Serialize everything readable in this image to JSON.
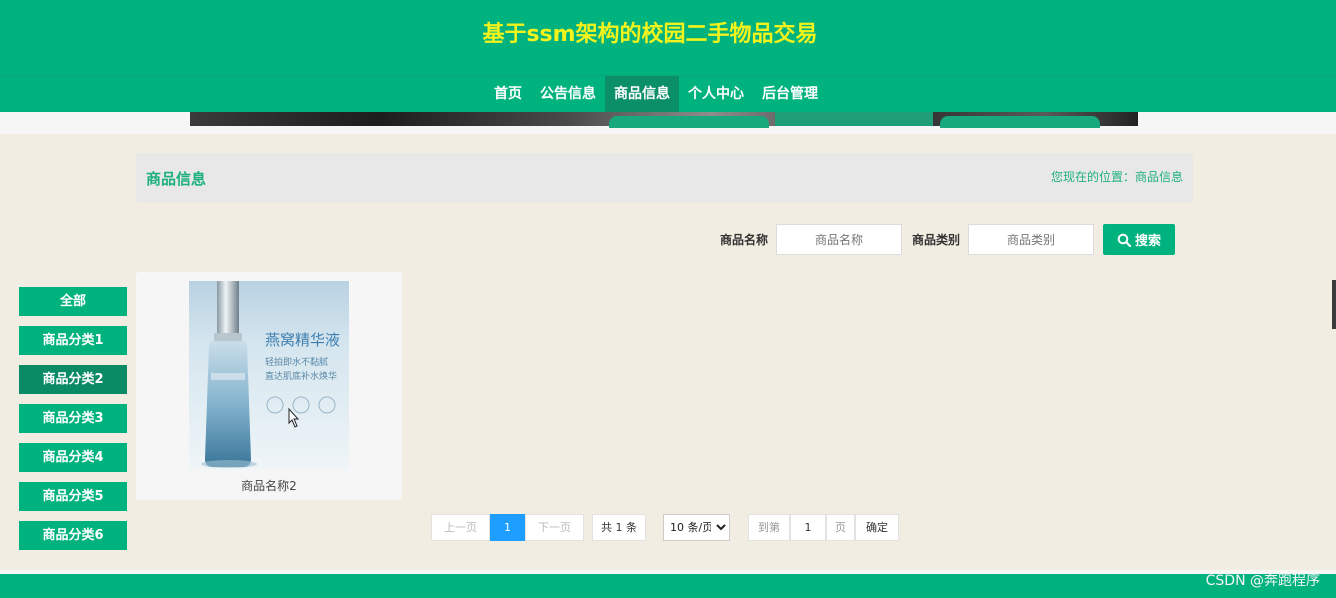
{
  "site": {
    "title": "基于ssm架构的校园二手物品交易"
  },
  "nav": {
    "items": [
      {
        "label": "首页"
      },
      {
        "label": "公告信息"
      },
      {
        "label": "商品信息",
        "active": true
      },
      {
        "label": "个人中心"
      },
      {
        "label": "后台管理"
      }
    ]
  },
  "page": {
    "title": "商品信息",
    "location": "您现在的位置：商品信息"
  },
  "search": {
    "name_label": "商品名称",
    "name_placeholder": "商品名称",
    "category_label": "商品类别",
    "category_placeholder": "商品类别",
    "button_label": "搜索"
  },
  "sidebar": {
    "items": [
      {
        "label": "全部"
      },
      {
        "label": "商品分类1"
      },
      {
        "label": "商品分类2",
        "active": true
      },
      {
        "label": "商品分类3"
      },
      {
        "label": "商品分类4"
      },
      {
        "label": "商品分类5"
      },
      {
        "label": "商品分类6"
      }
    ]
  },
  "products": [
    {
      "name": "商品名称2",
      "image_text": {
        "headline": "燕窝精华液",
        "line1": "轻拍即水不黏腻",
        "line2": "直达肌底补水焕华"
      }
    }
  ],
  "pager": {
    "prev": "上一页",
    "current": "1",
    "next": "下一页",
    "total": "共 1 条",
    "page_size": "10 条/页",
    "goto_label": "到第",
    "goto_value": "1",
    "unit": "页",
    "confirm": "确定"
  },
  "watermark": "CSDN @奔跑程序",
  "colors": {
    "brand": "#00b27e",
    "brand_dark": "#0b8a66",
    "title_yellow": "#f2f21c",
    "page_bg": "#f2ede2",
    "pager_active": "#1e9fff"
  }
}
